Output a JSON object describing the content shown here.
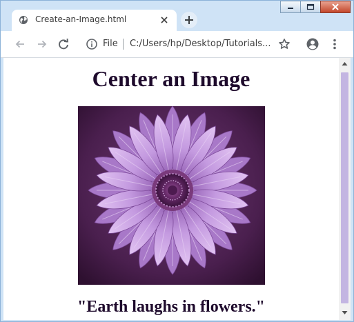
{
  "tab": {
    "title": "Create-an-Image.html"
  },
  "toolbar": {
    "scheme": "File",
    "url": "C:/Users/hp/Desktop/Tutorials..."
  },
  "page": {
    "heading": "Center an Image",
    "quote": "\"Earth laughs in flowers.\""
  },
  "icons": {
    "favicon": "globe-icon",
    "close": "close-icon",
    "new_tab": "plus-icon",
    "back": "arrow-left-icon",
    "forward": "arrow-right-icon",
    "reload": "reload-icon",
    "info": "info-icon",
    "bookmark": "star-icon",
    "profile": "account-icon",
    "menu": "kebab-icon"
  },
  "colors": {
    "frame": "#cfe3f6",
    "heading": "#1e0a2c",
    "scroll_thumb": "#c3b5e2",
    "flower_petal": "#c49ae0",
    "flower_background": "#4a1f4e"
  }
}
